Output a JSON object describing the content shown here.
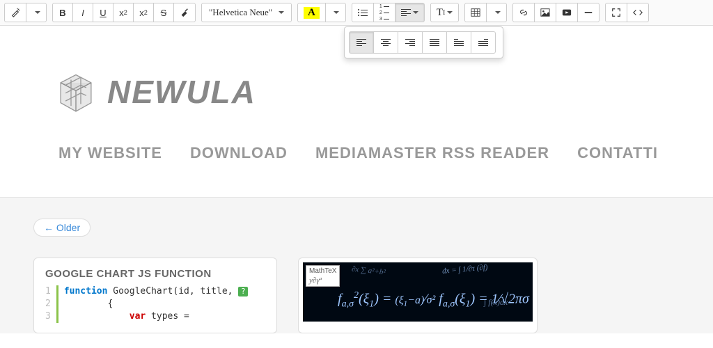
{
  "toolbar": {
    "font_family": "\"Helvetica Neue\"",
    "color_symbol": "A",
    "tsize_symbol": "T",
    "tsize_sub": "I"
  },
  "page": {
    "logo_text": "NEWULA"
  },
  "nav": {
    "items": [
      {
        "label": "MY WEBSITE"
      },
      {
        "label": "DOWNLOAD"
      },
      {
        "label": "MEDIAMASTER RSS READER"
      },
      {
        "label": "CONTATTI"
      }
    ]
  },
  "older_label": "← Older",
  "card1": {
    "title": "GOOGLE CHART JS FUNCTION",
    "code": {
      "lines": [
        "1",
        "2",
        "3"
      ],
      "l1_kw": "function",
      "l1_rest": " GoogleChart(id, title, ",
      "l2": "        {",
      "l3_indent": "            ",
      "l3_kw": "var",
      "l3_rest": " types ="
    }
  },
  "card2": {
    "badge_top": "MathTeX",
    "badge_sub": "y∂γª",
    "formula_main": "f<sub>a,σ</sub><sup>2</sup>(ξ<sub>1</sub>) = <span style='font-size:.8em'>(ξ<sub>1</sub>−a)</span>⁄<span style='font-size:.8em'>σ²</span> f<sub>a,σ</sub>(ξ<sub>1</sub>) = 1⁄√2πσ",
    "formula_bg1": "dx = ∫ 1/∂τ (∂f)",
    "formula_bg2": "∫ f(x)dx",
    "formula_bg3": "∂x ∑ a²+b²"
  }
}
